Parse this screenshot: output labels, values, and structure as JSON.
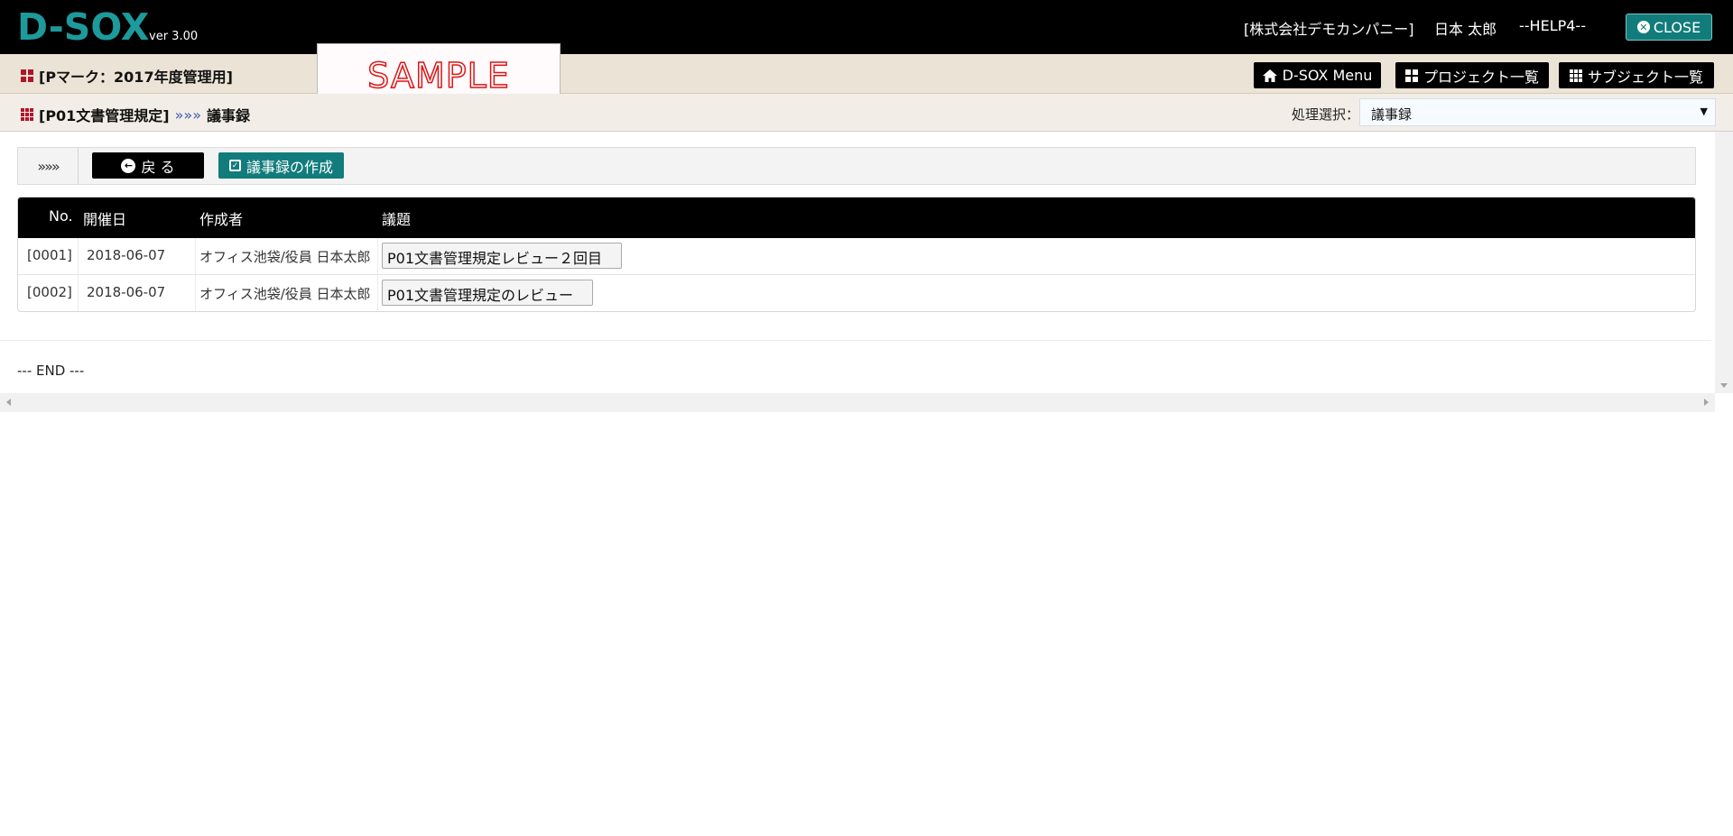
{
  "header": {
    "logo": "D-SOX",
    "version": "ver 3.00",
    "company": "[株式会社デモカンパニー]",
    "user": "日本 太郎",
    "help": "--HELP4--",
    "close_label": "CLOSE"
  },
  "project_bar": {
    "title": "[Pマーク：2017年度管理用]",
    "watermark": "SAMPLE",
    "nav": [
      {
        "label": "D-SOX Menu",
        "icon": "home-icon"
      },
      {
        "label": "プロジェクト一覧",
        "icon": "grid-icon"
      },
      {
        "label": "サブジェクト一覧",
        "icon": "th-icon"
      }
    ]
  },
  "breadcrumb": {
    "subject": "[P01文書管理規定]",
    "separator": "»»»",
    "current": "議事録",
    "process_label": "処理選択：",
    "process_value": "議事録"
  },
  "toolbar": {
    "chevrons": "»»»",
    "back_label": "戻 る",
    "create_label": "議事録の作成"
  },
  "table": {
    "headers": [
      "No.",
      "開催日",
      "作成者",
      "議題"
    ],
    "rows": [
      {
        "no": "[0001]",
        "date": "2018-06-07",
        "author": "オフィス池袋/役員 日本太郎",
        "topic": "P01文書管理規定レビュー２回目"
      },
      {
        "no": "[0002]",
        "date": "2018-06-07",
        "author": "オフィス池袋/役員 日本太郎",
        "topic": "P01文書管理規定のレビュー"
      }
    ]
  },
  "footer": {
    "end_text": "--- END ---"
  },
  "colors": {
    "logo": "#1d9a9b",
    "accent_teal": "#117c7b",
    "icon_red": "#b0142b",
    "project_bar_bg": "#ebe3d5",
    "crumb_bar_bg": "#f2eee7"
  }
}
